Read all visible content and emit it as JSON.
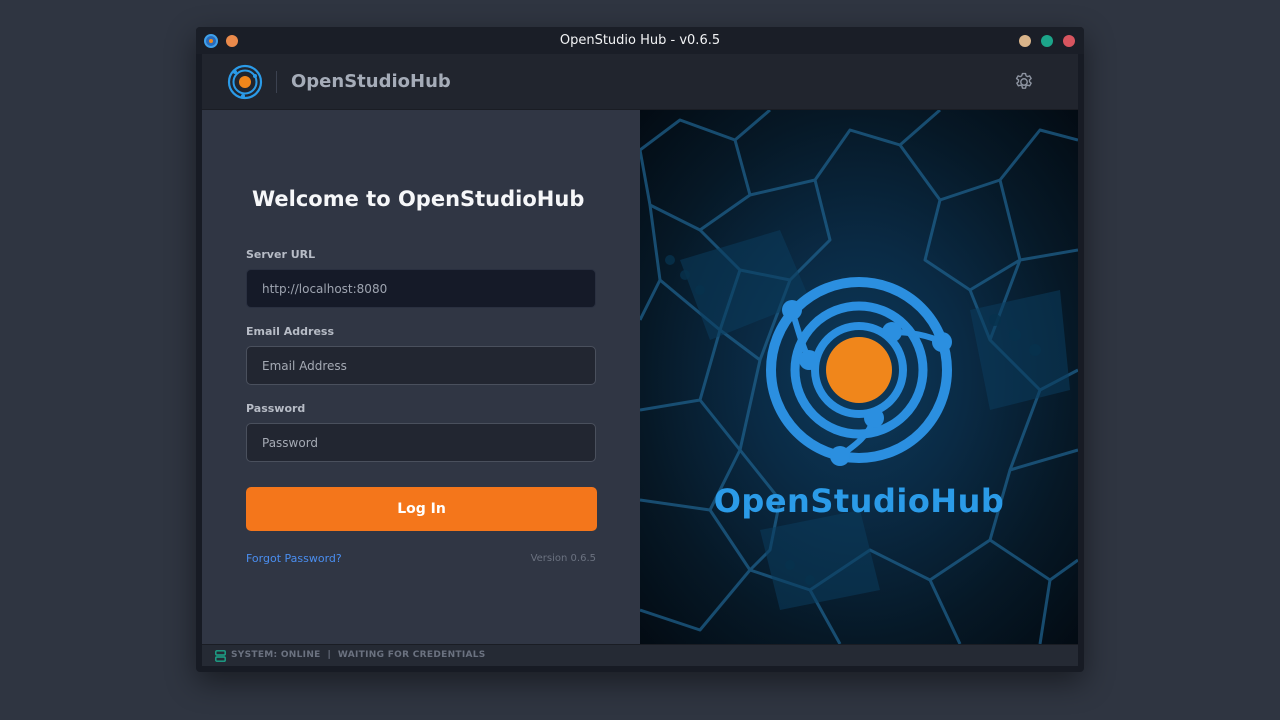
{
  "window": {
    "title": "OpenStudio Hub - v0.6.5"
  },
  "header": {
    "brand": "OpenStudioHub",
    "logo_icon": "orbit-logo-icon",
    "settings_icon": "gear-icon"
  },
  "login": {
    "heading": "Welcome to OpenStudioHub",
    "server_label": "Server URL",
    "server_placeholder": "http://localhost:8080",
    "email_label": "Email Address",
    "email_placeholder": "Email Address",
    "password_label": "Password",
    "password_placeholder": "Password",
    "submit_label": "Log In",
    "forgot_label": "Forgot Password?",
    "version_label": "Version 0.6.5"
  },
  "hero": {
    "title": "OpenStudioHub"
  },
  "status": {
    "text": "SYSTEM: ONLINE  |  WAITING FOR CREDENTIALS",
    "icon": "server-icon"
  },
  "colors": {
    "accent": "#f4761b",
    "brand_blue": "#2b9be8",
    "link": "#4a8ef0",
    "status_online": "#1ca58a"
  }
}
